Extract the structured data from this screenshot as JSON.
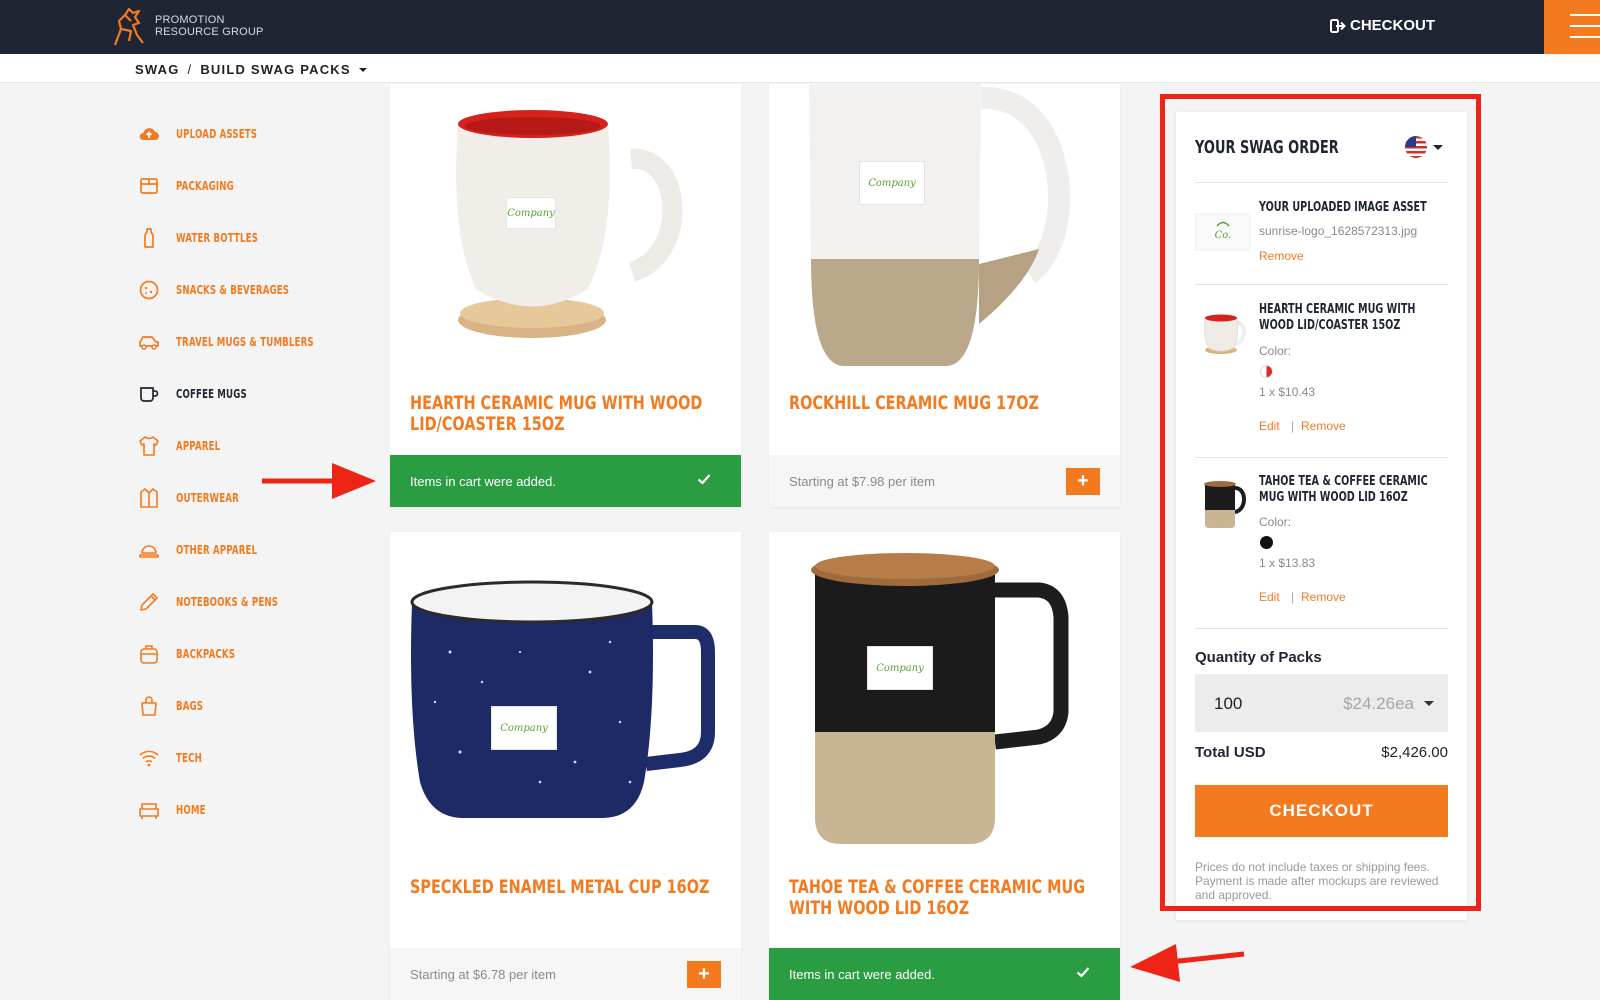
{
  "brand": {
    "line1": "PROMOTION",
    "line2": "RESOURCE GROUP"
  },
  "header": {
    "checkout_label": "CHECKOUT"
  },
  "breadcrumb": {
    "root": "SWAG",
    "separator": "/",
    "current": "BUILD SWAG PACKS"
  },
  "sidebar": {
    "items": [
      {
        "label": "UPLOAD ASSETS",
        "icon": "cloud-upload-icon"
      },
      {
        "label": "PACKAGING",
        "icon": "box-icon"
      },
      {
        "label": "WATER BOTTLES",
        "icon": "bottle-icon"
      },
      {
        "label": "SNACKS & BEVERAGES",
        "icon": "cookie-icon"
      },
      {
        "label": "TRAVEL MUGS & TUMBLERS",
        "icon": "car-icon"
      },
      {
        "label": "COFFEE MUGS",
        "icon": "mug-icon"
      },
      {
        "label": "APPAREL",
        "icon": "tshirt-icon"
      },
      {
        "label": "OUTERWEAR",
        "icon": "jacket-icon"
      },
      {
        "label": "OTHER APPAREL",
        "icon": "hat-icon"
      },
      {
        "label": "NOTEBOOKS & PENS",
        "icon": "pen-icon"
      },
      {
        "label": "BACKPACKS",
        "icon": "backpack-icon"
      },
      {
        "label": "BAGS",
        "icon": "bag-icon"
      },
      {
        "label": "TECH",
        "icon": "wifi-icon"
      },
      {
        "label": "HOME",
        "icon": "home-sofa-icon"
      }
    ],
    "active_label": "COFFEE MUGS"
  },
  "products": [
    {
      "title": "HEARTH CERAMIC MUG WITH WOOD LID/COASTER 15OZ",
      "added_msg": "Items in cart were added."
    },
    {
      "title": "ROCKHILL CERAMIC MUG 17OZ",
      "price": "Starting at $7.98 per item"
    },
    {
      "title": "SPECKLED ENAMEL METAL CUP 16OZ",
      "price": "Starting at $6.78 per item"
    },
    {
      "title": "TAHOE TEA & COFFEE CERAMIC MUG WITH WOOD LID 16OZ",
      "added_msg": "Items in cart were added."
    }
  ],
  "logo_patch_text": "Company",
  "order": {
    "title": "YOUR SWAG ORDER",
    "asset": {
      "name": "YOUR UPLOADED IMAGE ASSET",
      "file": "sunrise-logo_1628572313.jpg",
      "remove": "Remove"
    },
    "items": [
      {
        "name": "HEARTH CERAMIC MUG WITH WOOD LID/COASTER 15OZ",
        "color_label": "Color:",
        "qty_price": "1 x $10.43",
        "edit": "Edit",
        "remove": "Remove",
        "swatch": "#d82a2a"
      },
      {
        "name": "TAHOE TEA & COFFEE CERAMIC MUG WITH WOOD LID 16OZ",
        "color_label": "Color:",
        "qty_price": "1 x $13.83",
        "edit": "Edit",
        "remove": "Remove",
        "swatch": "#111111"
      }
    ],
    "qty_label": "Quantity of Packs",
    "qty_value": "100",
    "qty_price": "$24.26ea",
    "total_label": "Total USD",
    "total_value": "$2,426.00",
    "checkout_label": "CHECKOUT",
    "disclaimer": "Prices do not include taxes or shipping fees. Payment is made after mockups are reviewed and approved."
  },
  "colors": {
    "accent": "#f47a1f",
    "navy": "#1f2532",
    "success": "#2a9d42",
    "highlight": "#ee2417"
  }
}
